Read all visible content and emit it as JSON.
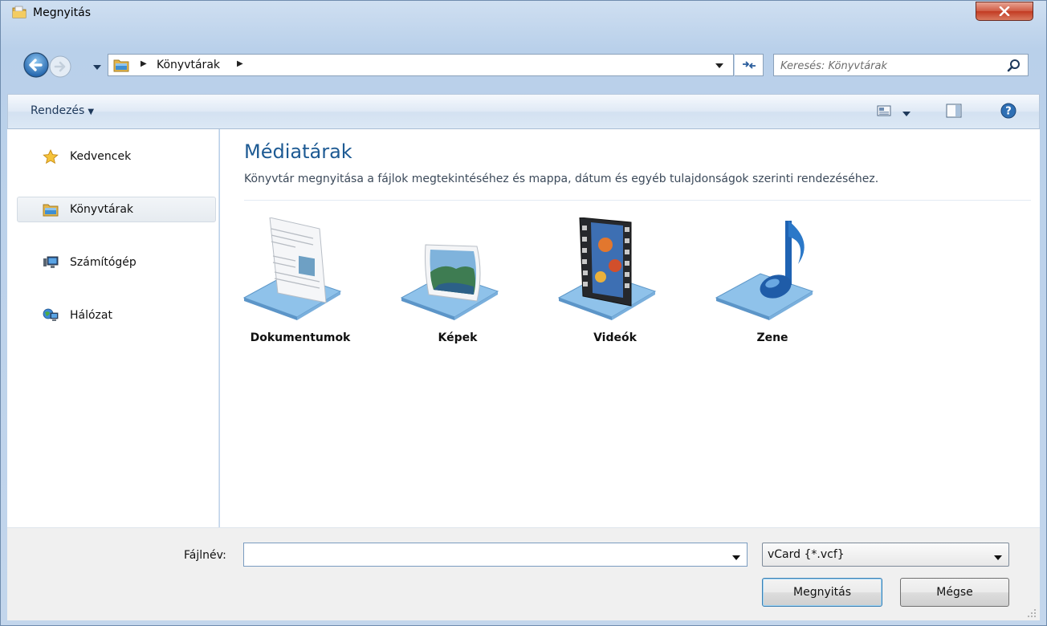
{
  "window": {
    "title": "Megnyitás",
    "close_label": "X"
  },
  "address_bar": {
    "breadcrumb": [
      "Könyvtárak"
    ],
    "search_placeholder": "Keresés: Könyvtárak"
  },
  "command_bar": {
    "organize_label": "Rendezés",
    "icons": [
      "change-view-icon",
      "preview-pane-icon",
      "help-icon"
    ]
  },
  "nav_pane": {
    "items": [
      {
        "label": "Kedvencek",
        "icon": "star-icon"
      },
      {
        "label": "Könyvtárak",
        "icon": "libraries-icon",
        "selected": true
      },
      {
        "label": "Számítógép",
        "icon": "computer-icon"
      },
      {
        "label": "Hálózat",
        "icon": "network-icon"
      }
    ]
  },
  "content": {
    "title": "Médiatárak",
    "description": "Könyvtár megnyitása a fájlok megtekintéséhez és mappa, dátum és egyéb tulajdonságok szerinti rendezéséhez.",
    "libraries": [
      {
        "label": "Dokumentumok",
        "icon": "documents-library-icon"
      },
      {
        "label": "Képek",
        "icon": "pictures-library-icon"
      },
      {
        "label": "Videók",
        "icon": "videos-library-icon"
      },
      {
        "label": "Zene",
        "icon": "music-library-icon"
      }
    ]
  },
  "bottom": {
    "filename_label": "Fájlnév:",
    "filename_value": "",
    "filetype_value": "vCard {*.vcf}",
    "open_button": "Megnyitás",
    "cancel_button": "Mégse"
  },
  "colors": {
    "title_blue": "#1d5a93",
    "close_red": "#c23a22",
    "frame_blue": "#b9d0ea"
  }
}
